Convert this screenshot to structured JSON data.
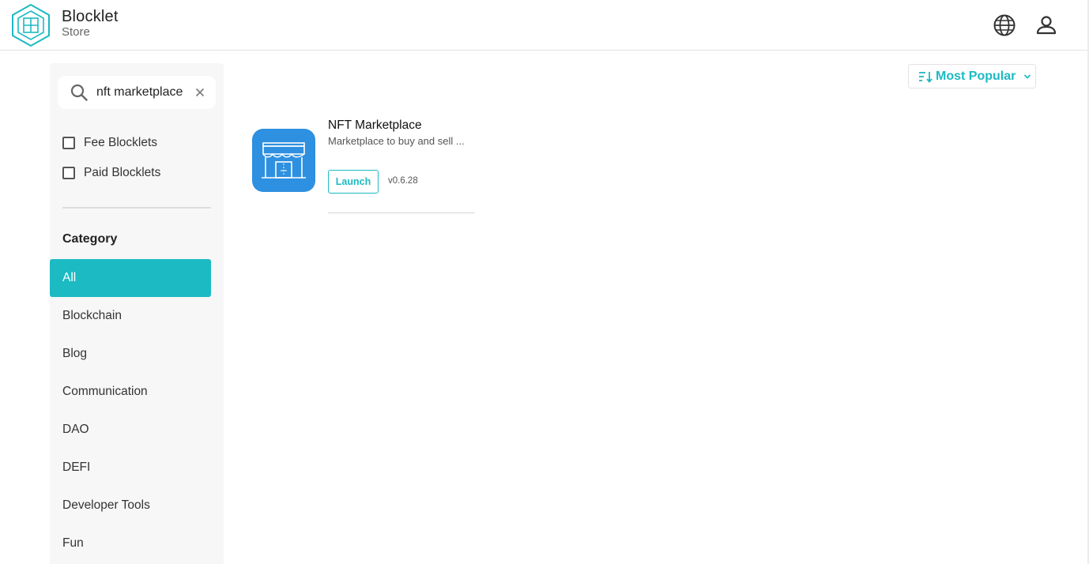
{
  "brand": {
    "name": "Blocklet",
    "sub": "Store",
    "accent_color": "#1cbac3"
  },
  "header": {
    "globe_icon": "globe-icon",
    "user_icon": "user-icon"
  },
  "search": {
    "value": "nft marketplace",
    "placeholder": ""
  },
  "filters": [
    {
      "label": "Fee Blocklets",
      "checked": false
    },
    {
      "label": "Paid Blocklets",
      "checked": false
    }
  ],
  "category": {
    "title": "Category",
    "items": [
      "All",
      "Blockchain",
      "Blog",
      "Communication",
      "DAO",
      "DEFI",
      "Developer Tools",
      "Fun"
    ],
    "active": "All"
  },
  "sort": {
    "label": "Most Popular"
  },
  "results": [
    {
      "title": "NFT Marketplace",
      "description": "Marketplace to buy and sell ...",
      "launch_label": "Launch",
      "version": "v0.6.28",
      "icon": "storefront-icon",
      "icon_color": "#2e90e0"
    }
  ]
}
